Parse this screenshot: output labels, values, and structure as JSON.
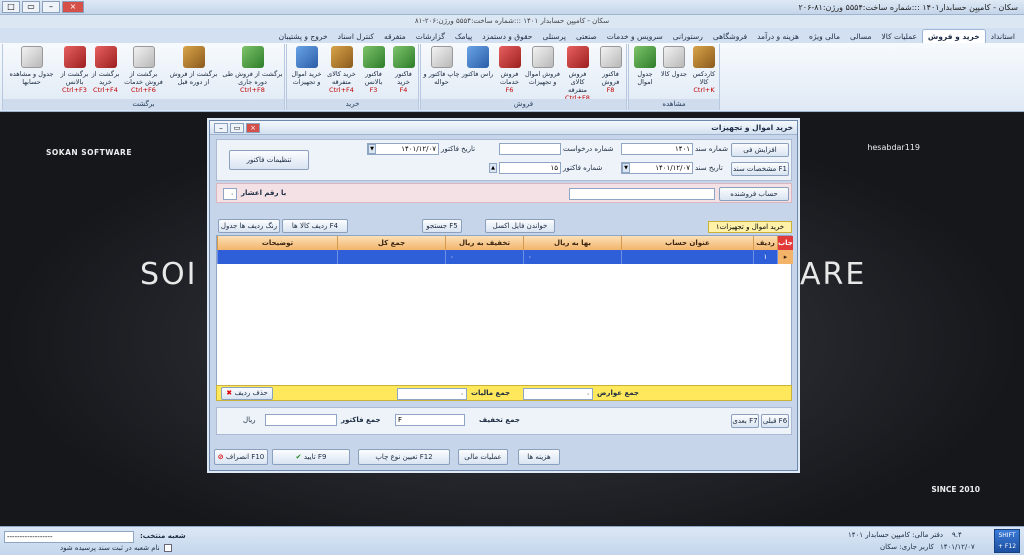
{
  "window": {
    "title": "سکان - کامپیِن حسابدار۱۴۰۱ :::شماره ساخت:۵۵۵۴ ورژن:۸۱-۲۰۶",
    "subtitle": "سکان - کامپیِن حسابدار ۱۴۰۱ :::شماره ساخت:۵۵۵۴ ورژن:۲۰۶-۸۱",
    "controls": [
      "□",
      "▭",
      "–",
      "×"
    ]
  },
  "tabs": [
    {
      "label": "استانداد",
      "active": false
    },
    {
      "label": "خرید و فروش",
      "active": true
    },
    {
      "label": "عملیات کالا",
      "active": false
    },
    {
      "label": "مسالی",
      "active": false
    },
    {
      "label": "مالی ویژه",
      "active": false
    },
    {
      "label": "هزینه و درآمد",
      "active": false
    },
    {
      "label": "فروشگاهی",
      "active": false
    },
    {
      "label": "رستورانی",
      "active": false
    },
    {
      "label": "سرویس و خدمات",
      "active": false
    },
    {
      "label": "صنعتی",
      "active": false
    },
    {
      "label": "پرسنلی",
      "active": false
    },
    {
      "label": "حقوق و دستمزد",
      "active": false
    },
    {
      "label": "پیامک",
      "active": false
    },
    {
      "label": "گزارشات",
      "active": false
    },
    {
      "label": "متفرقه",
      "active": false
    },
    {
      "label": "کنترل اسناد",
      "active": false
    },
    {
      "label": "خروج و پشتیبان",
      "active": false
    }
  ],
  "ribbon": {
    "groups": [
      {
        "name": "مشاهده",
        "buttons": [
          {
            "label": "کاردکس کالا",
            "shortcut": "Ctrl+K",
            "icon": "box-icon"
          },
          {
            "label": "جدول کالا",
            "shortcut": "",
            "icon": "table-icon"
          },
          {
            "label": "جدول اموال",
            "shortcut": "",
            "icon": "grid-icon"
          }
        ]
      },
      {
        "name": "فروش",
        "buttons": [
          {
            "label": "فاکتور فروش",
            "shortcut": "F8",
            "icon": "invoice-icon"
          },
          {
            "label": "فروش کالای متفرقه",
            "shortcut": "Ctrl+F8",
            "icon": "cart-icon"
          },
          {
            "label": "فروش اموال و تجهیزات",
            "shortcut": "",
            "icon": "equipment-icon"
          },
          {
            "label": "فروش خدمات",
            "shortcut": "F6",
            "icon": "service-icon"
          },
          {
            "label": "راس فاکتور",
            "shortcut": "",
            "icon": "tools-icon"
          },
          {
            "label": "چاپ فاکتور و حواله",
            "shortcut": "",
            "icon": "print-icon"
          }
        ]
      },
      {
        "name": "خرید",
        "buttons": [
          {
            "label": "فاکتور خرید",
            "shortcut": "F4",
            "icon": "purchase-icon"
          },
          {
            "label": "فاکتور بالانس",
            "shortcut": "F3",
            "icon": "balance-icon"
          },
          {
            "label": "خرید کالای متفرقه",
            "shortcut": "Ctrl+F4",
            "icon": "cart-icon"
          },
          {
            "label": "خرید اموال و تجهیزات",
            "shortcut": "",
            "icon": "equipment-icon"
          }
        ]
      },
      {
        "name": "برگشت",
        "buttons": [
          {
            "label": "برگشت از فروش طی دوره جاری",
            "shortcut": "Ctrl+F8",
            "icon": "return-icon"
          },
          {
            "label": "برگشت از فروش از دوره قبل",
            "shortcut": "",
            "icon": "return-prev-icon"
          },
          {
            "label": "برگشت از فروش خدمات",
            "shortcut": "Ctrl+F6",
            "icon": "return-service-icon"
          },
          {
            "label": "برگشت از خرید",
            "shortcut": "Ctrl+F4",
            "icon": "return-purchase-icon"
          },
          {
            "label": "برگشت از بالانس",
            "shortcut": "Ctrl+F3",
            "icon": "return-balance-icon"
          },
          {
            "label": "جدول و مشاهده حسابها",
            "shortcut": "",
            "icon": "accounts-icon"
          }
        ]
      }
    ]
  },
  "workspace": {
    "brand_left": "SOKAN SOFTWARE",
    "brand_right": "hesabdar119",
    "big_left": "SOI",
    "big_right": "ARE",
    "since": "SINCE 2010"
  },
  "dialog": {
    "title": "خرید اموال و تجهیزات",
    "controls": [
      "–",
      "▭",
      "×"
    ],
    "fields": {
      "doc_no_label": "شماره سند",
      "doc_no": "۱۴۰۱",
      "request_no_label": "شماره درخواست",
      "request_no": "",
      "invoice_date_label": "تاریخ فاکتور",
      "invoice_date": "۱۴۰۱/۱۲/۰۷",
      "doc_date_label": "تاریخ سند",
      "doc_date": "۱۴۰۱/۱۲/۰۷",
      "invoice_no_label": "شماره فاکتور",
      "invoice_no": "۱۵",
      "seller_label": "حساب فروشنده",
      "seller": "",
      "float_label": "با رقم اعشار",
      "float_value": "۰",
      "tab_label": "خرید اموال و تجهیزات۱"
    },
    "buttons": {
      "increase": "افزایش فی",
      "doc_spec": "مشخصات سند F1",
      "invoice_settings": "تنظیمات فاکتور",
      "read_excel": "خواندن فایل اکسل",
      "search_f5": "جستجو F5",
      "rows_f4": "ردیف کالا ها F4",
      "color_row": "رنگ ردیف ها جدول",
      "delete_row": "حذف ردیف",
      "prev_f6": "قبلی F6",
      "next_f7": "بعدی F7",
      "costs": "هزینه ها",
      "financial_ops": "عملیات مالی",
      "print_type": "تعیین نوع چاپ F12",
      "confirm": "تایید F9",
      "cancel": "انصراف F10"
    },
    "grid": {
      "headers": [
        "جاب",
        "ردیف",
        "عنوان حساب",
        "بها به ریال",
        "تخفیف به ریال",
        "جمع کل",
        "توضیحات"
      ],
      "rows": [
        {
          "select": "▸",
          "row": "۱",
          "account": "",
          "price": "۰",
          "discount": "۰",
          "total": "",
          "desc": ""
        }
      ]
    },
    "totals": {
      "tolls_label": "جمع عوارض",
      "tolls": "۰",
      "tax_label": "جمع مالیات",
      "tax": "۰",
      "discount_label": "جمع تخفیف",
      "discount": "F",
      "invoice_total_label": "جمع فاکتور",
      "invoice_total": "",
      "currency": "ریال"
    }
  },
  "status": {
    "branch_label": "شعبه منتخب:",
    "branch_value": "------------------",
    "checkbox_label": "نام شعبه در ثبت سند پرسیده شود",
    "company": "دفتر مالی: کامپیِن حسابدار ۱۴۰۱",
    "user": "کاربر جاری: سکان",
    "date": "۱۴۰۱/۱۲/۰۷",
    "version": "۹.۴",
    "shift": "SHIFT + F12"
  }
}
